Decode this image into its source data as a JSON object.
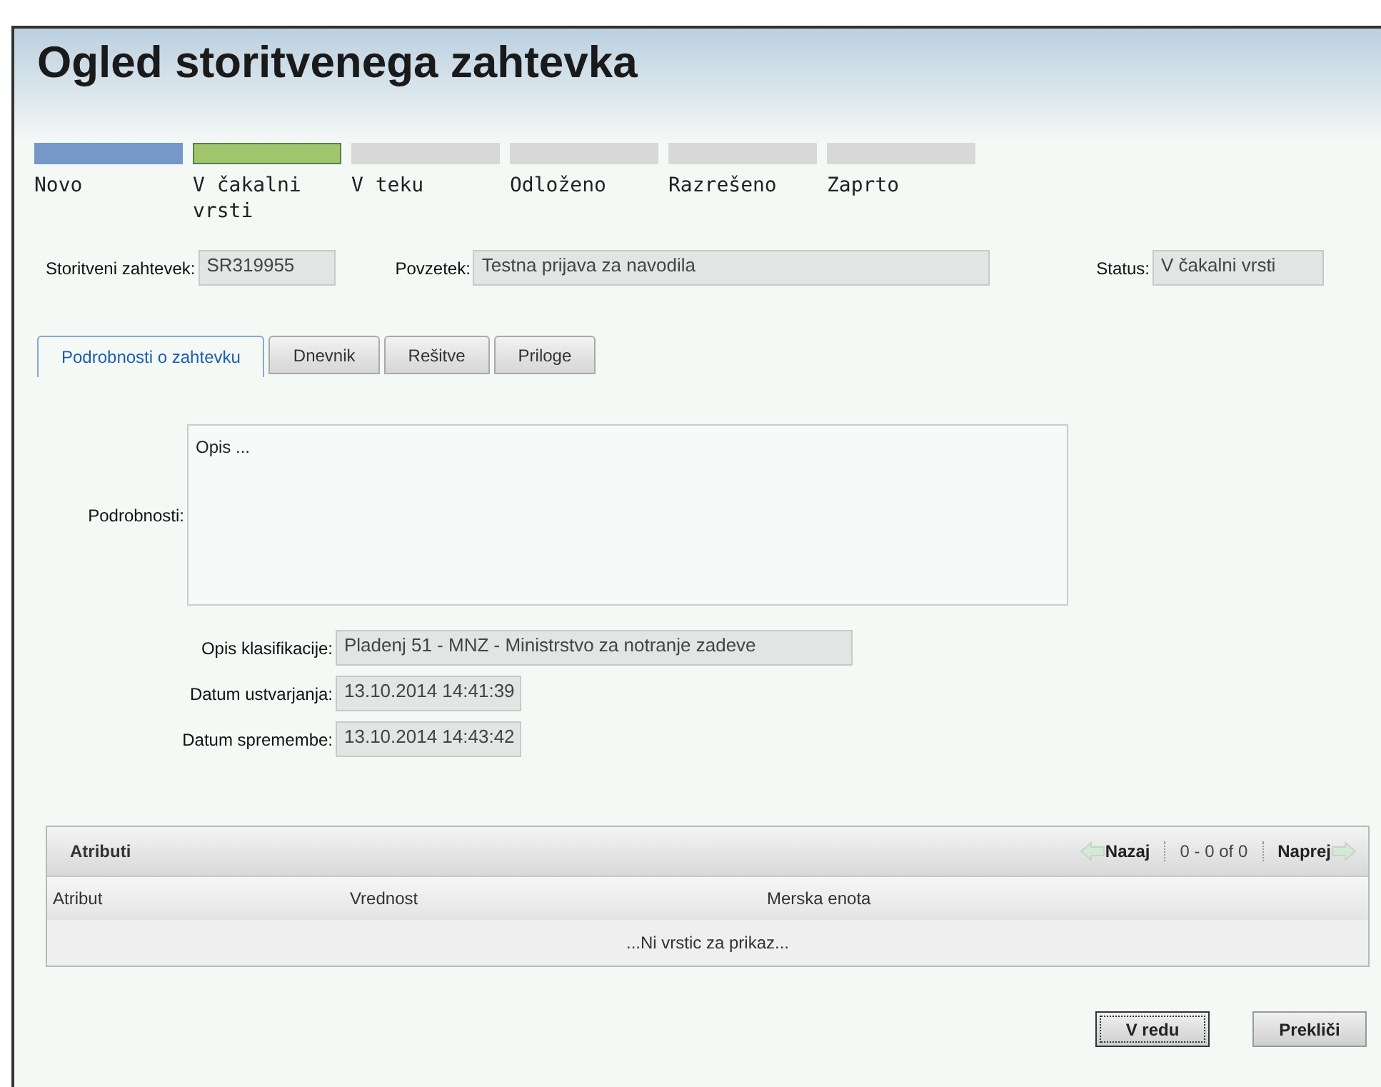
{
  "title": "Ogled storitvenega zahtevka",
  "steps": [
    {
      "label": "Novo",
      "completed": true,
      "current": false
    },
    {
      "label": "V čakalni vrsti",
      "completed": false,
      "current": true
    },
    {
      "label": "V teku",
      "completed": false,
      "current": false
    },
    {
      "label": "Odloženo",
      "completed": false,
      "current": false
    },
    {
      "label": "Razrešeno",
      "completed": false,
      "current": false
    },
    {
      "label": "Zaprto",
      "completed": false,
      "current": false
    }
  ],
  "header_fields": [
    {
      "label": "Storitveni zahtevek:",
      "value": "SR319955"
    },
    {
      "label": "Povzetek:",
      "value": "Testna prijava za navodila"
    },
    {
      "label": "Status:",
      "value": "V čakalni vrsti"
    }
  ],
  "tabs": [
    {
      "label": "Podrobnosti o zahtevku",
      "selected": true
    },
    {
      "label": "Dnevnik",
      "selected": false
    },
    {
      "label": "Rešitve",
      "selected": false
    },
    {
      "label": "Priloge",
      "selected": false
    }
  ],
  "details": {
    "label": "Podrobnosti:",
    "value": "Opis ..."
  },
  "fields": [
    {
      "label": "Opis klasifikacije:",
      "value": "Pladenj 51 - MNZ - Ministrstvo za notranje zadeve"
    },
    {
      "label": "Datum ustvarjanja:",
      "value": "13.10.2014 14:41:39"
    },
    {
      "label": "Datum spremembe:",
      "value": "13.10.2014 14:43:42"
    }
  ],
  "attributes": {
    "title": "Atributi",
    "prev": "Nazaj",
    "range": "0 - 0 of 0",
    "next": "Naprej",
    "columns": [
      "Atribut",
      "Vrednost",
      "Merska enota"
    ],
    "empty": "...Ni vrstic za prikaz..."
  },
  "buttons": [
    {
      "label": "V redu",
      "focused": true
    },
    {
      "label": "Prekliči",
      "focused": false
    }
  ]
}
